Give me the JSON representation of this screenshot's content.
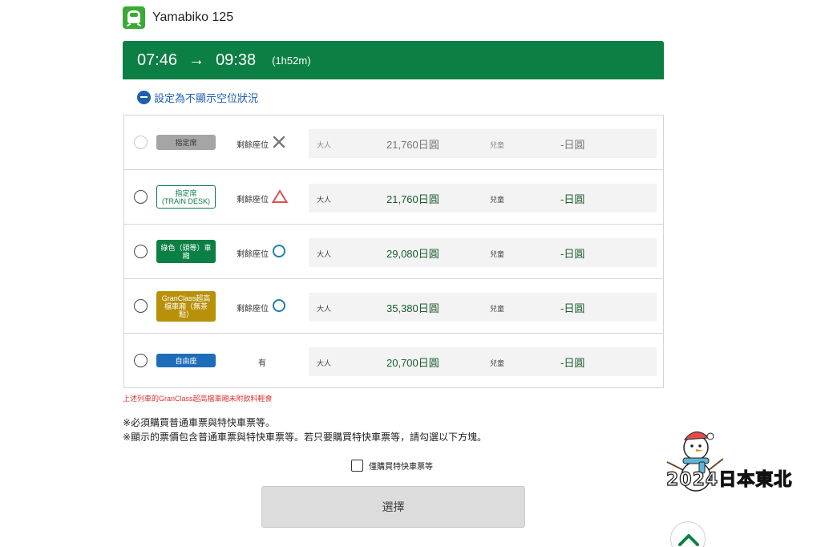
{
  "train": {
    "name": "Yamabiko 125"
  },
  "time": {
    "depart": "07:46",
    "arrow": "→",
    "arrive": "09:38",
    "duration": "(1h52m)"
  },
  "vacancy_toggle": {
    "label": "設定為不顯示空位狀況"
  },
  "rows": [
    {
      "badge": "指定席",
      "vacancy_label": "剩餘座位",
      "vacancy_icon": "cross-icon",
      "adult_label": "大人",
      "adult_price": "21,760日圓",
      "child_label": "兒童",
      "child_price": "-日圓",
      "disabled": true
    },
    {
      "badge": "指定席\n(TRAIN DESK)",
      "vacancy_label": "剩餘座位",
      "vacancy_icon": "triangle-icon",
      "adult_label": "大人",
      "adult_price": "21,760日圓",
      "child_label": "兒童",
      "child_price": "-日圓"
    },
    {
      "badge": "綠色（頭等）車\n廂",
      "vacancy_label": "剩餘座位",
      "vacancy_icon": "circle-icon",
      "adult_label": "大人",
      "adult_price": "29,080日圓",
      "child_label": "兒童",
      "child_price": "-日圓"
    },
    {
      "badge": "GranClass超高\n檔車廂（無茶\n點）",
      "vacancy_label": "剩餘座位",
      "vacancy_icon": "circle-icon",
      "adult_label": "大人",
      "adult_price": "35,380日圓",
      "child_label": "兒童",
      "child_price": "-日圓"
    },
    {
      "badge": "自由座",
      "vacancy_label": "有",
      "adult_label": "大人",
      "adult_price": "20,700日圓",
      "child_label": "兒童",
      "child_price": "-日圓"
    }
  ],
  "notes": {
    "red": "上述列車的GranClass超高檔車廂未附飲料輕食",
    "line1": "※必須購買普通車票與特快車票等。",
    "line2": "※顯示的票價包含普通車票與特快車票等。若只要購買特快車票等，請勾選以下方塊。"
  },
  "express_only": {
    "label": "僅購買特快車票等"
  },
  "select_button": {
    "label": "選擇"
  },
  "watermark": {
    "text": "2024日本東北"
  },
  "colors": {
    "brand_green": "#0c7f45",
    "icon_green": "#3aaa35",
    "link_blue": "#1e5fb0",
    "cross_gray": "#777777",
    "triangle_red": "#d9534f",
    "circle_blue": "#1f7fa8",
    "badge_gray": "#a5a5a5",
    "badge_green": "#0c7f45",
    "badge_gold": "#b8900a",
    "badge_blue": "#1e6db8",
    "price_green": "#1a5c2e",
    "note_red": "#dd3333"
  }
}
